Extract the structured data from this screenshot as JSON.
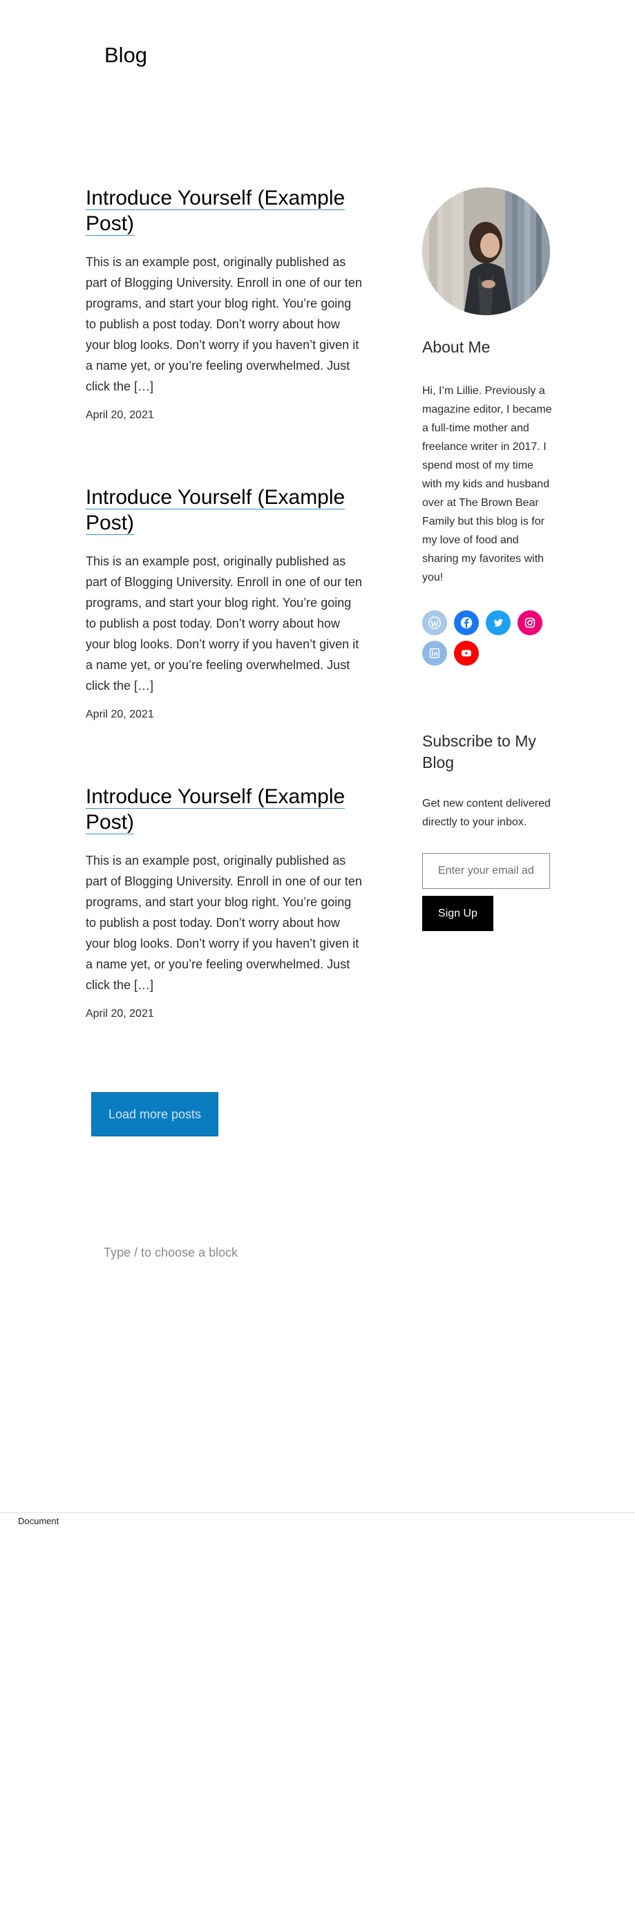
{
  "page": {
    "title": "Blog"
  },
  "posts": [
    {
      "title": "Introduce Yourself (Example Post)",
      "excerpt": "This is an example post, originally published as part of Blogging University. Enroll in one of our ten programs, and start your blog right. You’re going to publish a post today. Don’t worry about how your blog looks. Don’t worry if you haven’t given it a name yet, or you’re feeling overwhelmed. Just click the […]",
      "date": "April 20, 2021"
    },
    {
      "title": "Introduce Yourself (Example Post)",
      "excerpt": "This is an example post, originally published as part of Blogging University. Enroll in one of our ten programs, and start your blog right. You’re going to publish a post today. Don’t worry about how your blog looks. Don’t worry if you haven’t given it a name yet, or you’re feeling overwhelmed. Just click the […]",
      "date": "April 20, 2021"
    },
    {
      "title": "Introduce Yourself (Example Post)",
      "excerpt": "This is an example post, originally published as part of Blogging University. Enroll in one of our ten programs, and start your blog right. You’re going to publish a post today. Don’t worry about how your blog looks. Don’t worry if you haven’t given it a name yet, or you’re feeling overwhelmed. Just click the […]",
      "date": "April 20, 2021"
    }
  ],
  "load_more": {
    "label": "Load more posts"
  },
  "editor": {
    "placeholder": "Type / to choose a block"
  },
  "sidebar": {
    "about": {
      "heading": "About Me",
      "text": "Hi, I’m Lillie. Previously a magazine editor, I became a full-time mother and freelance writer in 2017. I spend most of my time with my kids and husband over at The Brown Bear Family but this blog is for my love of food and sharing my favorites with you!"
    },
    "socials": [
      {
        "icon": "wordpress-icon",
        "color": "#a7c8e6"
      },
      {
        "icon": "facebook-icon",
        "color": "#1877f2"
      },
      {
        "icon": "twitter-icon",
        "color": "#1da1f2"
      },
      {
        "icon": "instagram-icon",
        "color": "#f00075"
      },
      {
        "icon": "linkedin-icon",
        "color": "#8fb8e3"
      },
      {
        "icon": "youtube-icon",
        "color": "#ff0000"
      }
    ],
    "subscribe": {
      "heading": "Subscribe to My Blog",
      "text": "Get new content delivered directly to your inbox.",
      "email_placeholder": "Enter your email address",
      "button_label": "Sign Up"
    }
  },
  "footer": {
    "label": "Document"
  }
}
